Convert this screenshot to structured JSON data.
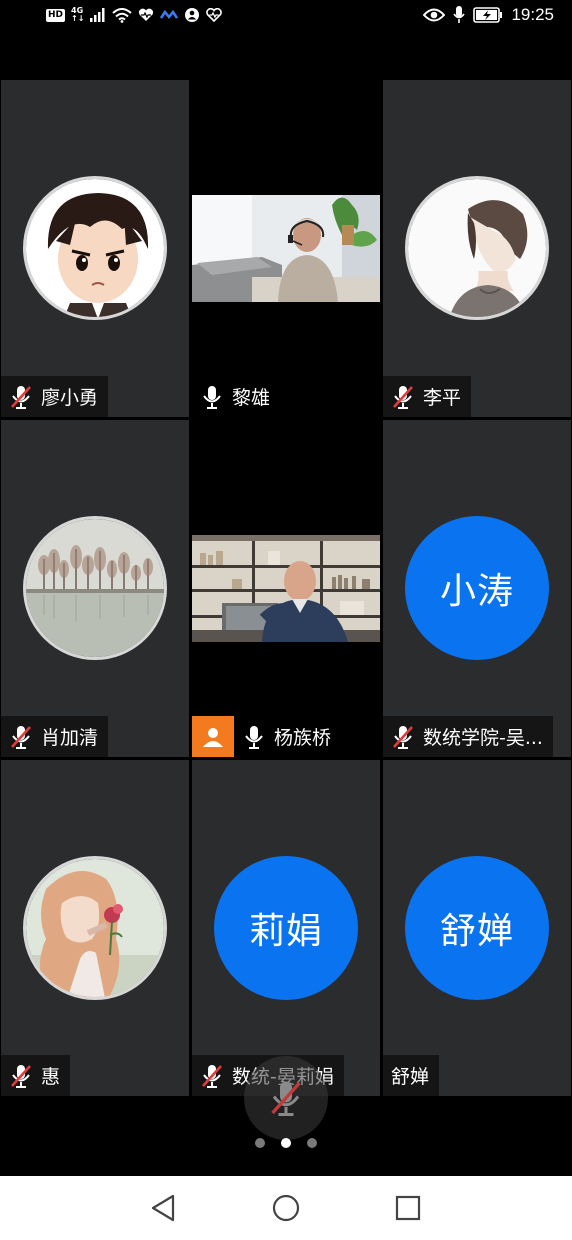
{
  "status_bar": {
    "hd": "HD",
    "network_top": "4G",
    "network_bottom": "↑↓",
    "time": "19:25"
  },
  "participants": [
    {
      "name": "廖小勇",
      "muted": true,
      "avatar": "cartoon-boy-avatar"
    },
    {
      "name": "黎雄",
      "muted": false,
      "video": "man-with-headset-video"
    },
    {
      "name": "李平",
      "muted": true,
      "avatar": "anime-boy-avatar"
    },
    {
      "name": "肖加清",
      "muted": true,
      "avatar": "lake-trees-avatar"
    },
    {
      "name": "杨族桥",
      "muted": false,
      "video": "bald-man-bookshelf-video",
      "host_badge": true
    },
    {
      "name": "数统学院-吴...",
      "muted": true,
      "initials": "小涛"
    },
    {
      "name": "惠",
      "muted": true,
      "avatar": "girl-with-rose-avatar"
    },
    {
      "name": "数统-晏莉娟",
      "muted": true,
      "initials": "莉娟"
    },
    {
      "name": "舒婵",
      "muted": false,
      "no_mic": true,
      "initials": "舒婵"
    }
  ],
  "colors": {
    "tile_bg": "#2b2c2e",
    "initials_bg": "#0a74f0",
    "muted_red": "#e23b3b",
    "host_badge": "#f47a20"
  },
  "pager": {
    "pages": 3,
    "current": 2
  }
}
